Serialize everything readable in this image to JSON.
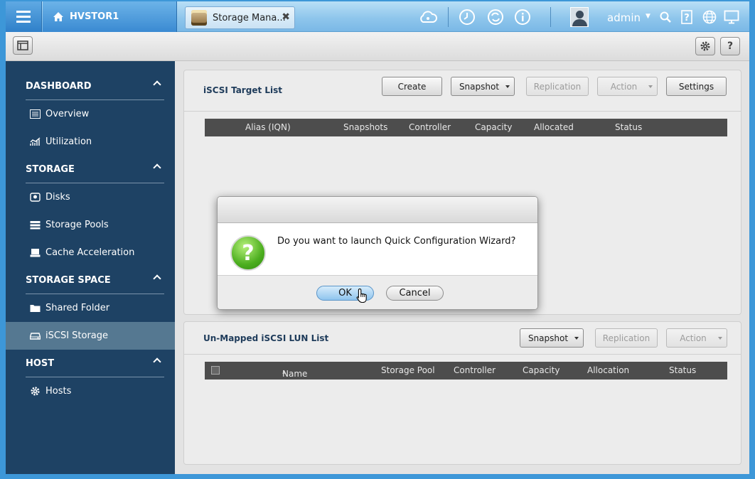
{
  "topbar": {
    "home_label": "HVSTOR1",
    "app_tab_label": "Storage Mana...",
    "app_tab_close": "✖",
    "user": "admin",
    "icons": [
      "cloud-icon",
      "clock-icon",
      "sync-icon",
      "info-icon",
      "search-icon",
      "help-icon",
      "globe-icon",
      "monitor-icon"
    ]
  },
  "toolbar": {
    "settings_icon": "gear-icon",
    "help_label": "?"
  },
  "sidebar": {
    "sections": [
      {
        "title": "DASHBOARD",
        "items": [
          "Overview",
          "Utilization"
        ]
      },
      {
        "title": "STORAGE",
        "items": [
          "Disks",
          "Storage Pools",
          "Cache Acceleration"
        ]
      },
      {
        "title": "STORAGE SPACE",
        "items": [
          "Shared Folder",
          "iSCSI Storage"
        ]
      },
      {
        "title": "HOST",
        "items": [
          "Hosts"
        ]
      }
    ],
    "active_item": "iSCSI Storage"
  },
  "target_panel": {
    "title": "iSCSI Target List",
    "buttons": {
      "create": "Create",
      "snapshot": "Snapshot",
      "replication": "Replication",
      "action": "Action",
      "settings": "Settings"
    },
    "columns": [
      "Alias (IQN)",
      "Snapshots",
      "Controller",
      "Capacity",
      "Allocated",
      "Status"
    ]
  },
  "lun_panel": {
    "title": "Un-Mapped iSCSI LUN List",
    "buttons": {
      "snapshot": "Snapshot",
      "replication": "Replication",
      "action": "Action"
    },
    "columns": [
      "Name",
      "Storage Pool",
      "Controller",
      "Capacity",
      "Allocation",
      "Status"
    ],
    "sort_indicator": "▲"
  },
  "dialog": {
    "message": "Do you want to launch Quick Configuration Wizard?",
    "icon_glyph": "?",
    "ok_label": "OK",
    "cancel_label": "Cancel"
  }
}
